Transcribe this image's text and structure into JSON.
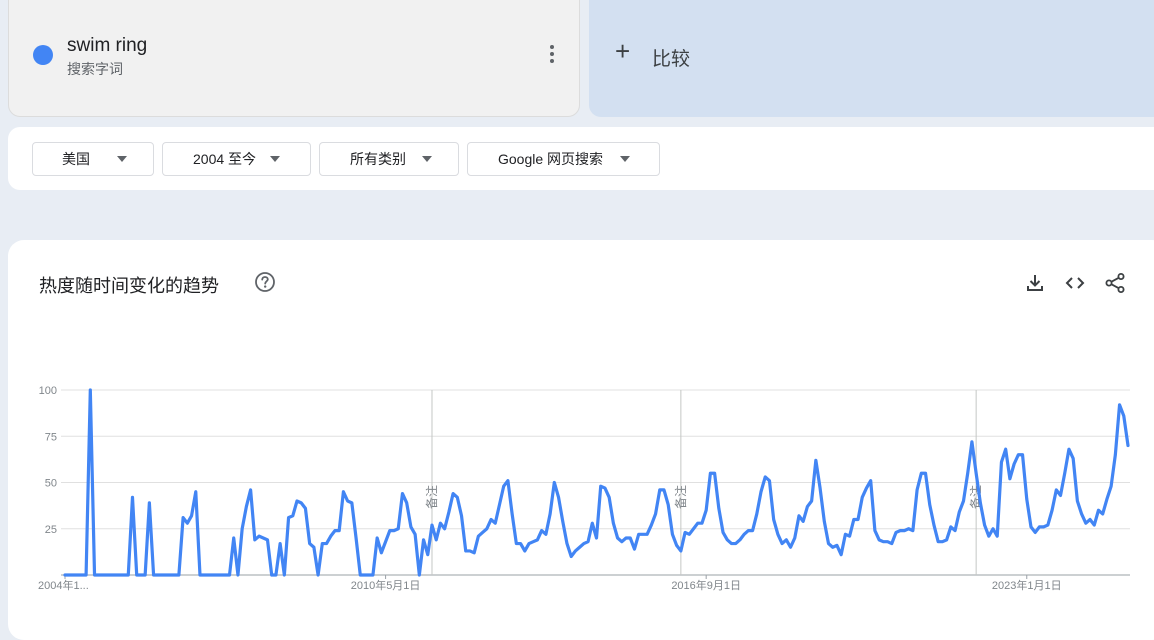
{
  "term": {
    "name": "swim ring",
    "subtitle": "搜索字词",
    "color": "#4285f4"
  },
  "compare": {
    "label": "比较"
  },
  "filters": [
    {
      "label": "美国"
    },
    {
      "label": "2004 至今"
    },
    {
      "label": "所有类别"
    },
    {
      "label": "Google 网页搜索"
    }
  ],
  "chart_header": {
    "title": "热度随时间变化的趋势",
    "icons": [
      "help-icon",
      "download-icon",
      "embed-code-icon",
      "share-icon"
    ]
  },
  "chart_data": {
    "type": "line",
    "title": "",
    "xlabel": "",
    "ylabel": "",
    "ylim": [
      0,
      100
    ],
    "y_ticks": [
      100,
      75,
      50,
      25
    ],
    "grid": true,
    "x_tick_labels": [
      {
        "label": "2004年1...",
        "month_index": 0
      },
      {
        "label": "2010年5月1日",
        "month_index": 76
      },
      {
        "label": "2016年9月1日",
        "month_index": 152
      },
      {
        "label": "2023年1月1日",
        "month_index": 228
      }
    ],
    "annotations": [
      {
        "label": "备注",
        "month_index": 87
      },
      {
        "label": "备注",
        "month_index": 146
      },
      {
        "label": "备注",
        "month_index": 216
      }
    ],
    "series": [
      {
        "name": "swim ring",
        "color": "#4285f4",
        "start": "2004-01",
        "interval": "month",
        "values": [
          0,
          0,
          0,
          0,
          0,
          0,
          100,
          0,
          0,
          0,
          0,
          0,
          0,
          0,
          0,
          0,
          42,
          0,
          0,
          0,
          39,
          0,
          0,
          0,
          0,
          0,
          0,
          0,
          31,
          28,
          32,
          45,
          0,
          0,
          0,
          0,
          0,
          0,
          0,
          0,
          20,
          0,
          25,
          37,
          46,
          19,
          21,
          20,
          19,
          0,
          0,
          17,
          0,
          31,
          32,
          40,
          39,
          36,
          17,
          15,
          0,
          17,
          17,
          21,
          24,
          24,
          45,
          40,
          39,
          20,
          0,
          0,
          0,
          0,
          20,
          12,
          18,
          24,
          24,
          25,
          44,
          39,
          26,
          22,
          0,
          19,
          11,
          27,
          19,
          28,
          25,
          34,
          44,
          42,
          32,
          13,
          13,
          12,
          21,
          23,
          25,
          30,
          28,
          38,
          48,
          51,
          33,
          17,
          17,
          13,
          17,
          18,
          19,
          24,
          22,
          33,
          50,
          42,
          29,
          17,
          10,
          13,
          15,
          17,
          18,
          28,
          20,
          48,
          47,
          42,
          28,
          20,
          18,
          20,
          20,
          14,
          22,
          22,
          22,
          27,
          33,
          46,
          46,
          38,
          22,
          16,
          13,
          23,
          22,
          25,
          28,
          28,
          35,
          55,
          55,
          36,
          23,
          19,
          17,
          17,
          19,
          22,
          24,
          24,
          33,
          45,
          53,
          51,
          30,
          22,
          17,
          19,
          15,
          20,
          32,
          29,
          37,
          40,
          62,
          47,
          29,
          17,
          15,
          16,
          11,
          22,
          21,
          30,
          30,
          42,
          47,
          51,
          24,
          19,
          18,
          18,
          17,
          23,
          24,
          24,
          25,
          24,
          46,
          55,
          55,
          38,
          27,
          18,
          18,
          19,
          26,
          24,
          34,
          40,
          55,
          72,
          55,
          39,
          27,
          21,
          25,
          21,
          61,
          68,
          52,
          60,
          65,
          65,
          41,
          26,
          23,
          26,
          26,
          27,
          35,
          46,
          43,
          55,
          68,
          63,
          40,
          33,
          28,
          30,
          27,
          35,
          33,
          41,
          48,
          65,
          92,
          86,
          70
        ]
      }
    ]
  }
}
